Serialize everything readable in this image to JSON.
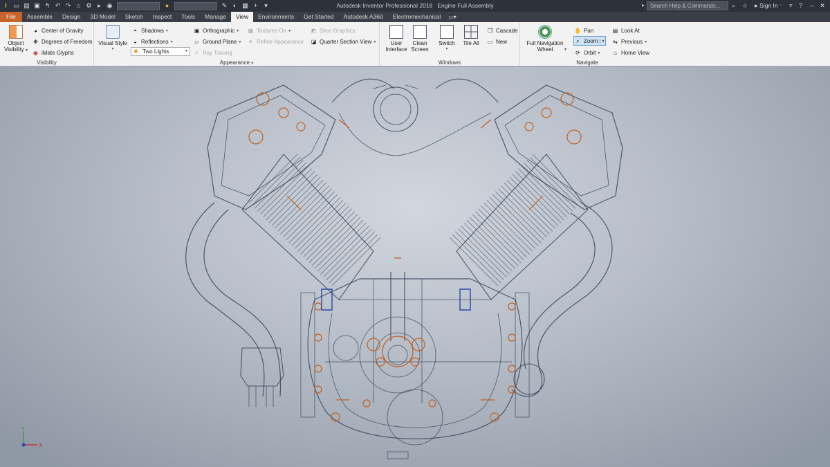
{
  "app": {
    "title": "Autodesk Inventor Professional 2018",
    "document": "Engine Full Assembly",
    "search_placeholder": "Search Help & Commands...",
    "sign_in": "Sign In",
    "logo": "I"
  },
  "tabs": [
    "File",
    "Assemble",
    "Design",
    "3D Model",
    "Sketch",
    "Inspect",
    "Tools",
    "Manage",
    "View",
    "Environments",
    "Get Started",
    "Autodesk A360",
    "Electromechanical"
  ],
  "active_tab": "View",
  "ribbon": {
    "visibility": {
      "label": "Visibility",
      "object_visibility": [
        "Object",
        "Visibility"
      ],
      "center_of_gravity": "Center of Gravity",
      "degrees_of_freedom": "Degrees of Freedom",
      "imate_glyphs": "iMate Glyphs"
    },
    "appearance": {
      "label": "Appearance",
      "visual_style": "Visual Style",
      "shadows": "Shadows",
      "reflections": "Reflections",
      "lighting": "Two Lights",
      "orthographic": "Orthographic",
      "ground_plane": "Ground Plane",
      "ray_tracing": "Ray Tracing",
      "textures_on": "Textures On",
      "refine_appearance": "Refine Appearance",
      "slice_graphics": "Slice Graphics",
      "quarter_section_view": "Quarter Section View"
    },
    "windows": {
      "label": "Windows",
      "user_interface": [
        "User",
        "Interface"
      ],
      "clean_screen": [
        "Clean",
        "Screen"
      ],
      "switch": "Switch",
      "tile_all": "Tile All",
      "cascade": "Cascade",
      "new": "New"
    },
    "navigate": {
      "label": "Navigate",
      "full_navigation_wheel": [
        "Full Navigation",
        "Wheel"
      ],
      "pan": "Pan",
      "zoom": "Zoom",
      "orbit": "Orbit",
      "look_at": "Look At",
      "previous": "Previous",
      "home_view": "Home View"
    }
  },
  "triad": {
    "x": "X",
    "y": "Y"
  },
  "colors": {
    "titlebar": "#2c313a",
    "file_tab": "#c8632a",
    "wire": "#3a4558",
    "highlight": "#c2601f",
    "select": "#2848a8"
  }
}
